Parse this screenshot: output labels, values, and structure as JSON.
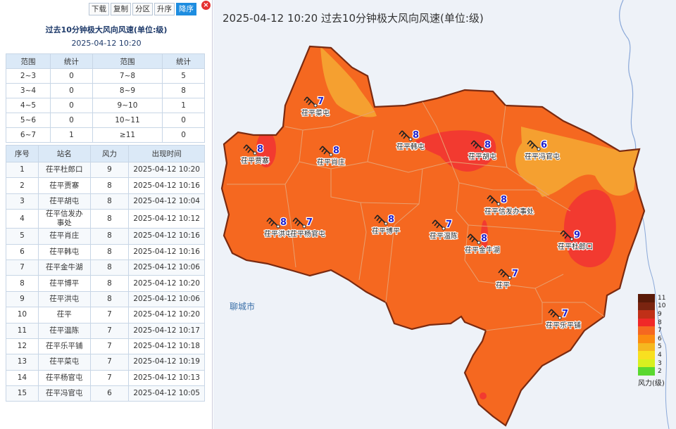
{
  "toolbar": {
    "download": "下载",
    "copy": "复制",
    "zone": "分区",
    "asc": "升序",
    "desc": "降序"
  },
  "panel": {
    "title": "过去10分钟极大风向风速(单位:级)",
    "time": "2025-04-12 10:20"
  },
  "stats": {
    "headers": [
      "范围",
      "统计",
      "范围",
      "统计"
    ],
    "rows": [
      [
        "2~3",
        "0",
        "7~8",
        "5"
      ],
      [
        "3~4",
        "0",
        "8~9",
        "8"
      ],
      [
        "4~5",
        "0",
        "9~10",
        "1"
      ],
      [
        "5~6",
        "0",
        "10~11",
        "0"
      ],
      [
        "6~7",
        "1",
        "≥11",
        "0"
      ]
    ]
  },
  "ranks": {
    "headers": [
      "序号",
      "站名",
      "风力",
      "出现时间"
    ],
    "rows": [
      [
        "1",
        "茌平杜郎口",
        "9",
        "2025-04-12 10:20"
      ],
      [
        "2",
        "茌平贾寨",
        "8",
        "2025-04-12 10:16"
      ],
      [
        "3",
        "茌平胡屯",
        "8",
        "2025-04-12 10:04"
      ],
      [
        "4",
        "茌平信发办事处",
        "8",
        "2025-04-12 10:12"
      ],
      [
        "5",
        "茌平肖庄",
        "8",
        "2025-04-12 10:16"
      ],
      [
        "6",
        "茌平韩屯",
        "8",
        "2025-04-12 10:16"
      ],
      [
        "7",
        "茌平金牛湖",
        "8",
        "2025-04-12 10:06"
      ],
      [
        "8",
        "茌平博平",
        "8",
        "2025-04-12 10:20"
      ],
      [
        "9",
        "茌平洪屯",
        "8",
        "2025-04-12 10:06"
      ],
      [
        "10",
        "茌平",
        "7",
        "2025-04-12 10:20"
      ],
      [
        "11",
        "茌平温陈",
        "7",
        "2025-04-12 10:17"
      ],
      [
        "12",
        "茌平乐平铺",
        "7",
        "2025-04-12 10:18"
      ],
      [
        "13",
        "茌平菜屯",
        "7",
        "2025-04-12 10:19"
      ],
      [
        "14",
        "茌平杨官屯",
        "7",
        "2025-04-12 10:13"
      ],
      [
        "15",
        "茌平冯官屯",
        "6",
        "2025-04-12 10:05"
      ]
    ]
  },
  "map": {
    "title": "2025-04-12 10:20 过去10分钟极大风向风速(单位:级)",
    "city": "聊城市",
    "stations": [
      {
        "name": "茌平菜屯",
        "value": "7"
      },
      {
        "name": "茌平贾寨",
        "value": "8"
      },
      {
        "name": "茌平肖庄",
        "value": "8"
      },
      {
        "name": "茌平韩屯",
        "value": "8"
      },
      {
        "name": "茌平胡屯",
        "value": "8"
      },
      {
        "name": "茌平冯官屯",
        "value": "6"
      },
      {
        "name": "茌平信发办事处",
        "value": "8"
      },
      {
        "name": "茌平洪屯",
        "value": "8"
      },
      {
        "name": "茌平杨官屯",
        "value": "7"
      },
      {
        "name": "茌平博平",
        "value": "8"
      },
      {
        "name": "茌平温陈",
        "value": "7"
      },
      {
        "name": "茌平金牛湖",
        "value": "8"
      },
      {
        "name": "茌平杜郎口",
        "value": "9"
      },
      {
        "name": "茌平",
        "value": "7"
      },
      {
        "name": "茌平乐平铺",
        "value": "7"
      }
    ],
    "legend": {
      "items": [
        {
          "label": "11",
          "color": "#5a1a08"
        },
        {
          "label": "10",
          "color": "#7a2410"
        },
        {
          "label": "9",
          "color": "#c03018"
        },
        {
          "label": "8",
          "color": "#f02828"
        },
        {
          "label": "7",
          "color": "#f56820"
        },
        {
          "label": "6",
          "color": "#fb8c10"
        },
        {
          "label": "5",
          "color": "#f5b820"
        },
        {
          "label": "4",
          "color": "#f8e020"
        },
        {
          "label": "3",
          "color": "#d8f020"
        },
        {
          "label": "2",
          "color": "#5ad830"
        }
      ],
      "unit": "风力(级)"
    }
  }
}
